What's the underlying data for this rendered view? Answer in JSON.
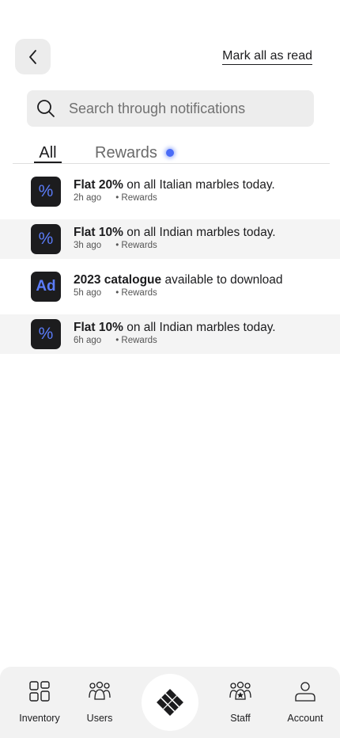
{
  "header": {
    "back_label": "",
    "mark_all_read": "Mark all as read"
  },
  "search": {
    "placeholder": "Search through notifications"
  },
  "tabs": {
    "all": "All",
    "rewards": "Rewards"
  },
  "notifications": [
    {
      "icon": "%",
      "bold": "Flat 20%",
      "text": " on all Italian marbles today.",
      "time": "2h ago",
      "category": "Rewards"
    },
    {
      "icon": "%",
      "bold": "Flat 10%",
      "text": " on all Indian marbles today.",
      "time": "3h ago",
      "category": "Rewards"
    },
    {
      "icon": "Ad",
      "bold": "2023 catalogue",
      "text": " available to download",
      "time": "5h ago",
      "category": "Rewards"
    },
    {
      "icon": "%",
      "bold": "Flat 10%",
      "text": " on all Indian marbles today.",
      "time": "6h ago",
      "category": "Rewards"
    }
  ],
  "nav": {
    "inventory": "Inventory",
    "users": "Users",
    "staff": "Staff",
    "account": "Account"
  },
  "colors": {
    "accent": "#4a6cf7",
    "icon_bg": "#1c1c1e",
    "icon_fg": "#5b7cfa"
  }
}
